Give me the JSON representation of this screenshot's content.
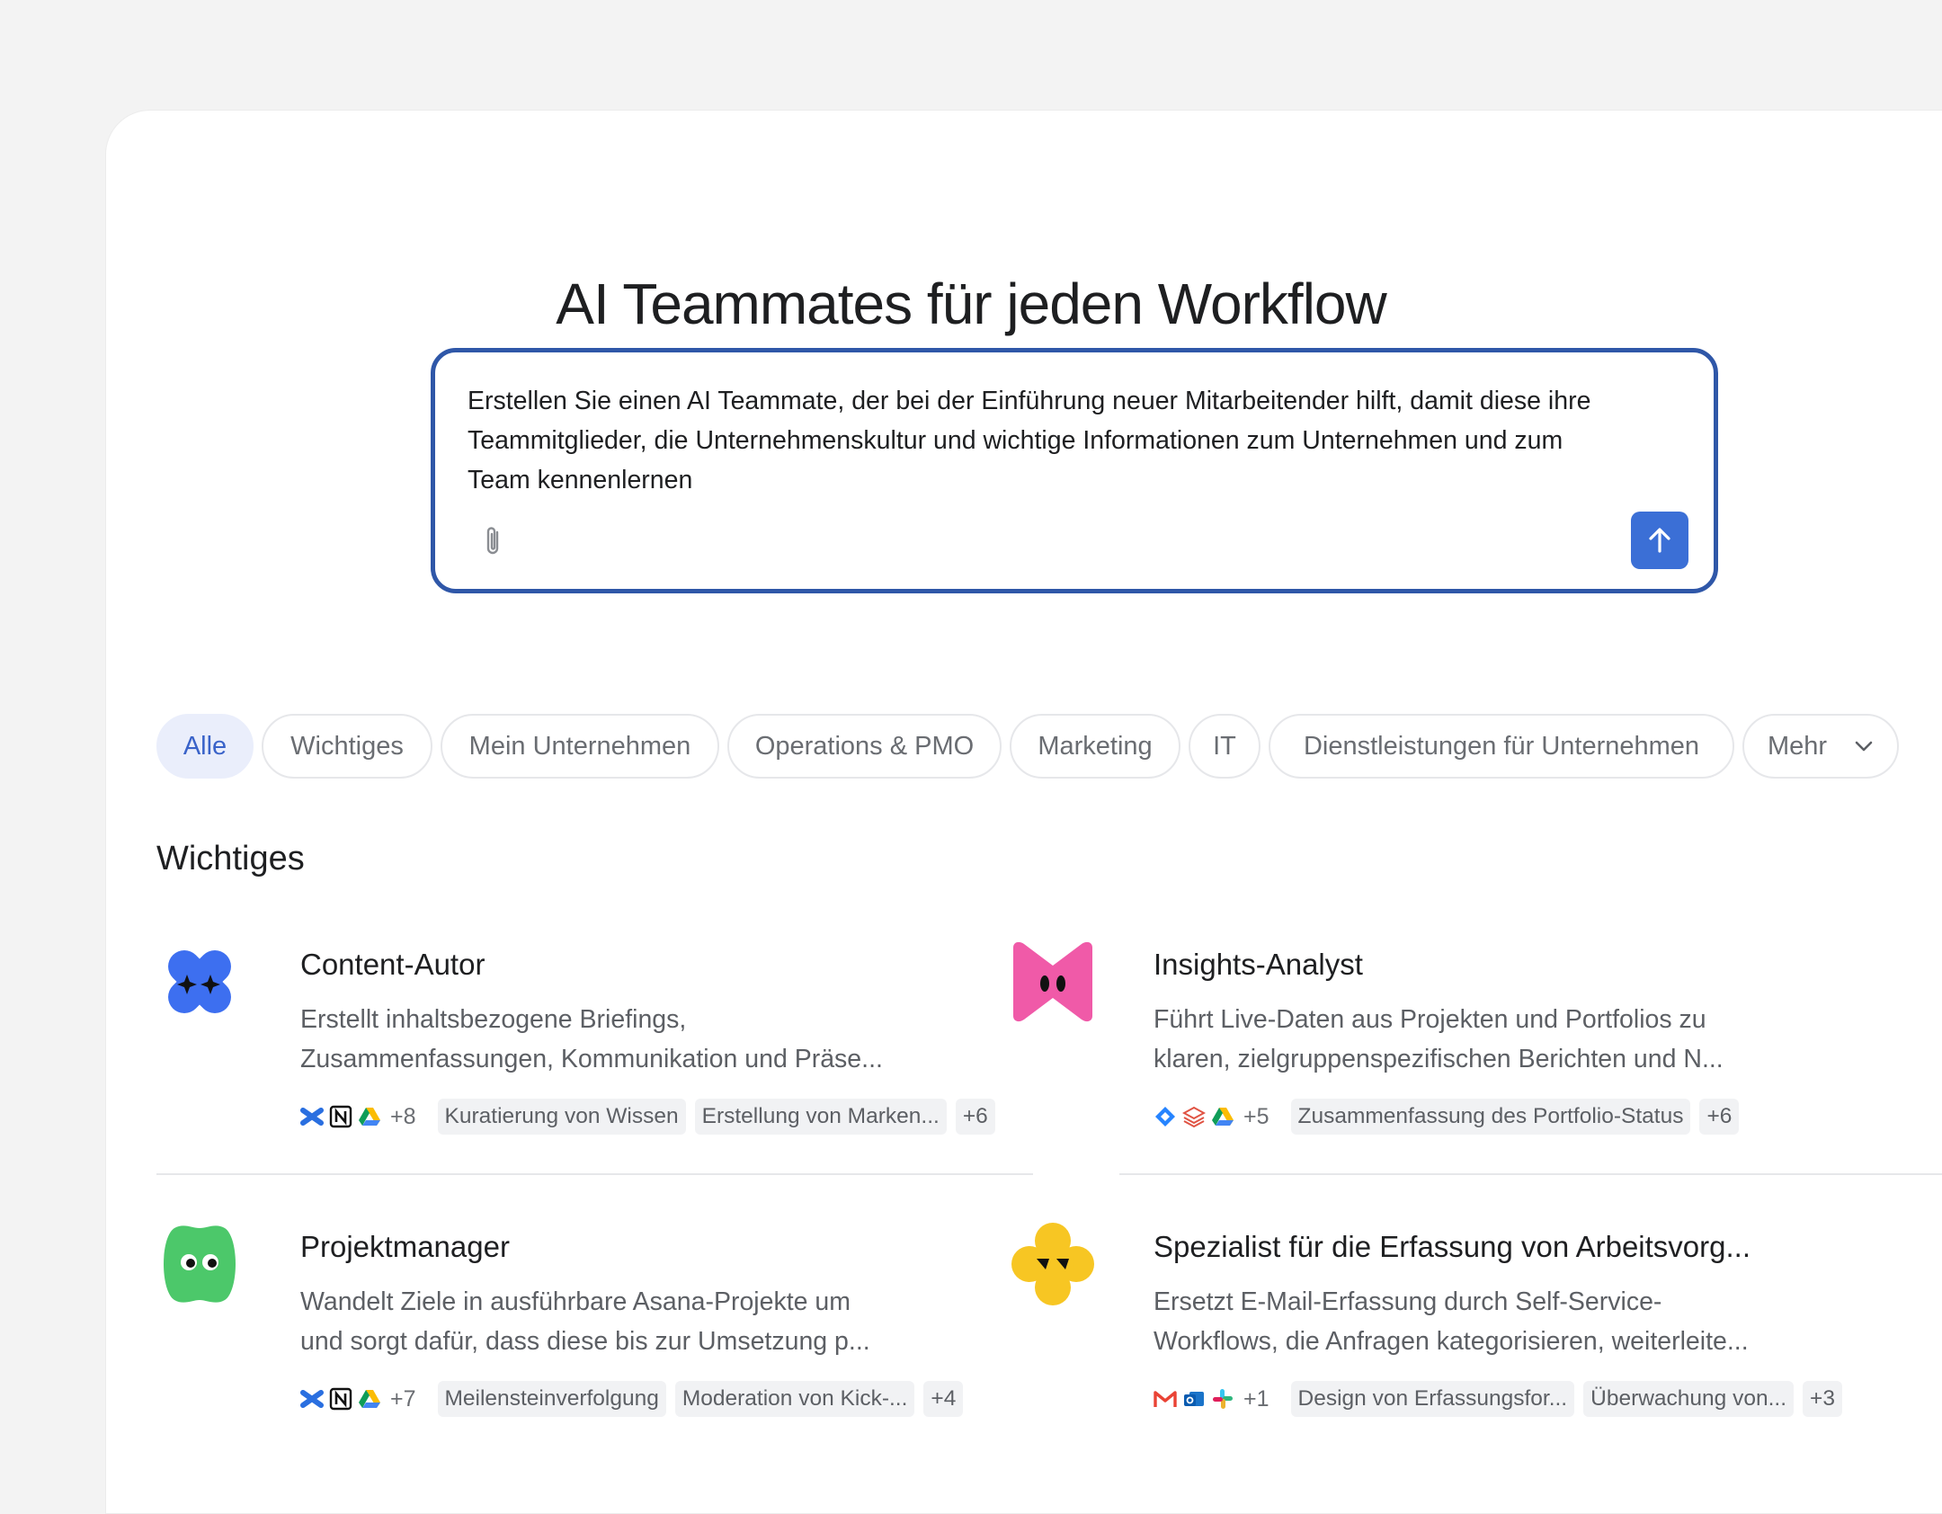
{
  "page": {
    "title": "AI Teammates für jeden Workflow"
  },
  "prompt": {
    "text": "Erstellen Sie einen AI Teammate, der bei der Einführung neuer Mitarbeitender hilft, damit diese ihre Teammitglieder, die Unternehmenskultur und wichtige Informationen zum Unternehmen und zum Team kennenlernen"
  },
  "filters": [
    {
      "label": "Alle",
      "active": true
    },
    {
      "label": "Wichtiges"
    },
    {
      "label": "Mein Unternehmen"
    },
    {
      "label": "Operations & PMO"
    },
    {
      "label": "Marketing"
    },
    {
      "label": "IT"
    },
    {
      "label": "Dienstleistungen für Unternehmen"
    },
    {
      "label": "Mehr"
    }
  ],
  "section": {
    "title": "Wichtiges"
  },
  "cards": [
    {
      "title": "Content-Autor",
      "desc_1": "Erstellt inhaltsbezogene Briefings,",
      "desc_2": "Zusammenfassungen, Kommunikation und Präse...",
      "more_apps": "+8",
      "tags": [
        "Kuratierung von Wissen",
        "Erstellung von Marken...",
        "+6"
      ],
      "icon": "blue-x-mascot-icon",
      "color": "#3d6ff0"
    },
    {
      "title": "Insights-Analyst",
      "desc_1": "Führt Live-Daten aus Projekten und Portfolios zu",
      "desc_2": "klaren, zielgruppenspezifischen Berichten und N...",
      "more_apps": "+5",
      "tags": [
        "Zusammenfassung des Portfolio-Status",
        "+6"
      ],
      "icon": "pink-bow-mascot-icon",
      "color": "#f05aa8"
    },
    {
      "title": "Projektmanager",
      "desc_1": "Wandelt Ziele in ausführbare Asana-Projekte um",
      "desc_2": "und sorgt dafür, dass diese bis zur Umsetzung p...",
      "more_apps": "+7",
      "tags": [
        "Meilensteinverfolgung",
        "Moderation von Kick-...",
        "+4"
      ],
      "icon": "green-blob-mascot-icon",
      "color": "#4cc86a"
    },
    {
      "title": "Spezialist für die Erfassung von Arbeitsvorg...",
      "desc_1": "Ersetzt E-Mail-Erfassung durch Self-Service-",
      "desc_2": "Workflows, die Anfragen kategorisieren, weiterleite...",
      "more_apps": "+1",
      "tags": [
        "Design von Erfassungsfor...",
        "Überwachung von...",
        "+3"
      ],
      "icon": "yellow-flower-mascot-icon",
      "color": "#f7c623"
    }
  ]
}
